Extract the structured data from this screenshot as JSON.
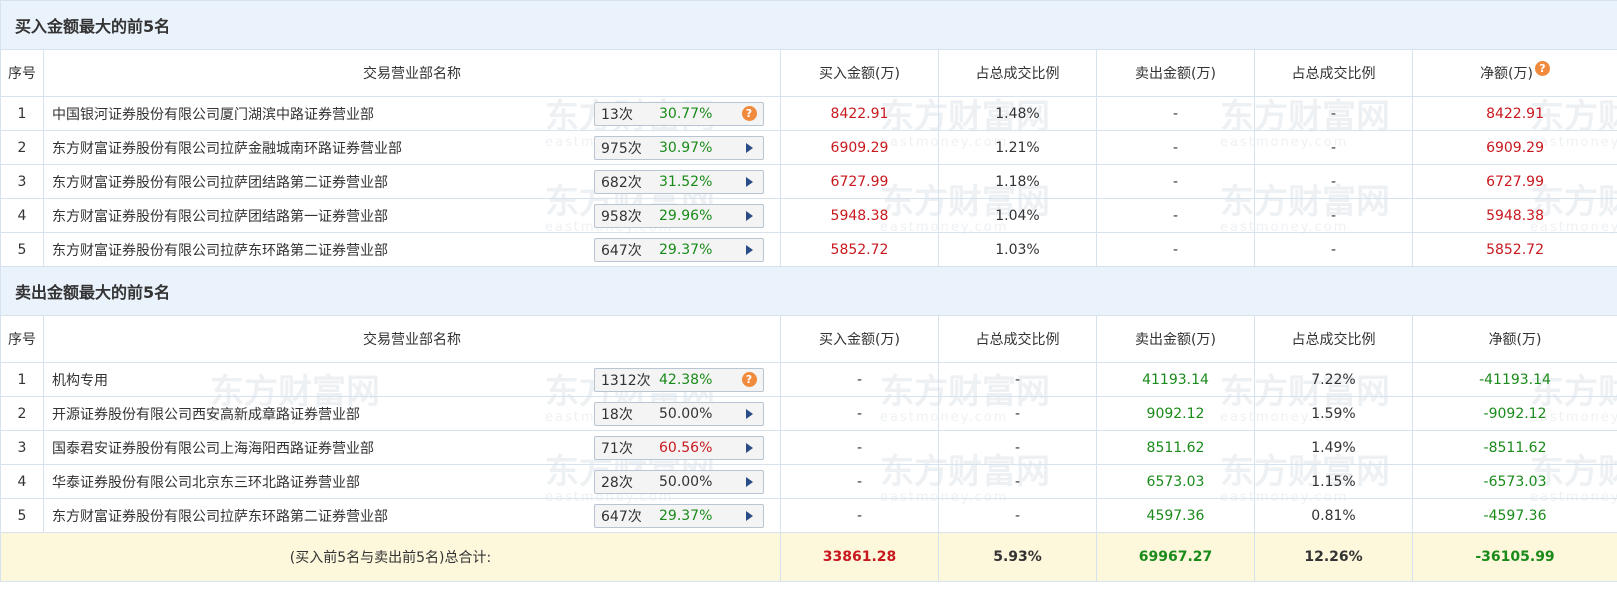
{
  "watermark": {
    "cn": "东方财富网",
    "en": "eastmoney.com"
  },
  "headers": [
    "序号",
    "交易营业部名称",
    "买入金额(万)",
    "占总成交比例",
    "卖出金额(万)",
    "占总成交比例",
    "净额(万)"
  ],
  "buy_section": {
    "title": "买入金额最大的前5名",
    "rows": [
      {
        "idx": "1",
        "name": "中国银河证券股份有限公司厦门湖滨中路证券营业部",
        "count": "13次",
        "pct": "30.77%",
        "pct_color": "green",
        "ctrl": "question",
        "buy": "8422.91",
        "buy_ratio": "1.48%",
        "sell": "-",
        "sell_ratio": "-",
        "net": "8422.91"
      },
      {
        "idx": "2",
        "name": "东方财富证券股份有限公司拉萨金融城南环路证券营业部",
        "count": "975次",
        "pct": "30.97%",
        "pct_color": "green",
        "ctrl": "arrow",
        "buy": "6909.29",
        "buy_ratio": "1.21%",
        "sell": "-",
        "sell_ratio": "-",
        "net": "6909.29"
      },
      {
        "idx": "3",
        "name": "东方财富证券股份有限公司拉萨团结路第二证券营业部",
        "count": "682次",
        "pct": "31.52%",
        "pct_color": "green",
        "ctrl": "arrow",
        "buy": "6727.99",
        "buy_ratio": "1.18%",
        "sell": "-",
        "sell_ratio": "-",
        "net": "6727.99"
      },
      {
        "idx": "4",
        "name": "东方财富证券股份有限公司拉萨团结路第一证券营业部",
        "count": "958次",
        "pct": "29.96%",
        "pct_color": "green",
        "ctrl": "arrow",
        "buy": "5948.38",
        "buy_ratio": "1.04%",
        "sell": "-",
        "sell_ratio": "-",
        "net": "5948.38"
      },
      {
        "idx": "5",
        "name": "东方财富证券股份有限公司拉萨东环路第二证券营业部",
        "count": "647次",
        "pct": "29.37%",
        "pct_color": "green",
        "ctrl": "arrow",
        "buy": "5852.72",
        "buy_ratio": "1.03%",
        "sell": "-",
        "sell_ratio": "-",
        "net": "5852.72"
      }
    ]
  },
  "sell_section": {
    "title": "卖出金额最大的前5名",
    "rows": [
      {
        "idx": "1",
        "name": "机构专用",
        "count": "1312次",
        "pct": "42.38%",
        "pct_color": "green",
        "ctrl": "question",
        "buy": "-",
        "buy_ratio": "-",
        "sell": "41193.14",
        "sell_ratio": "7.22%",
        "net": "-41193.14"
      },
      {
        "idx": "2",
        "name": "开源证券股份有限公司西安高新成章路证券营业部",
        "count": "18次",
        "pct": "50.00%",
        "pct_color": "dark",
        "ctrl": "arrow",
        "buy": "-",
        "buy_ratio": "-",
        "sell": "9092.12",
        "sell_ratio": "1.59%",
        "net": "-9092.12"
      },
      {
        "idx": "3",
        "name": "国泰君安证券股份有限公司上海海阳西路证券营业部",
        "count": "71次",
        "pct": "60.56%",
        "pct_color": "red",
        "ctrl": "arrow",
        "buy": "-",
        "buy_ratio": "-",
        "sell": "8511.62",
        "sell_ratio": "1.49%",
        "net": "-8511.62"
      },
      {
        "idx": "4",
        "name": "华泰证券股份有限公司北京东三环北路证券营业部",
        "count": "28次",
        "pct": "50.00%",
        "pct_color": "dark",
        "ctrl": "arrow",
        "buy": "-",
        "buy_ratio": "-",
        "sell": "6573.03",
        "sell_ratio": "1.15%",
        "net": "-6573.03"
      },
      {
        "idx": "5",
        "name": "东方财富证券股份有限公司拉萨东环路第二证券营业部",
        "count": "647次",
        "pct": "29.37%",
        "pct_color": "green",
        "ctrl": "arrow",
        "buy": "-",
        "buy_ratio": "-",
        "sell": "4597.36",
        "sell_ratio": "0.81%",
        "net": "-4597.36"
      }
    ]
  },
  "total": {
    "label": "(买入前5名与卖出前5名)总合计:",
    "buy": "33861.28",
    "buy_ratio": "5.93%",
    "sell": "69967.27",
    "sell_ratio": "12.26%",
    "net": "-36105.99"
  },
  "icons": {
    "question": "question-icon",
    "arrow": "triangle-right-icon"
  },
  "colors": {
    "section_bg": "#eaf2fb",
    "border": "#d6e3ef",
    "red": "#c8191f",
    "green": "#1a8b1a",
    "total_bg": "#fdf7dc",
    "question_icon": "#f08a3c",
    "arrow": "#2a4c86"
  }
}
